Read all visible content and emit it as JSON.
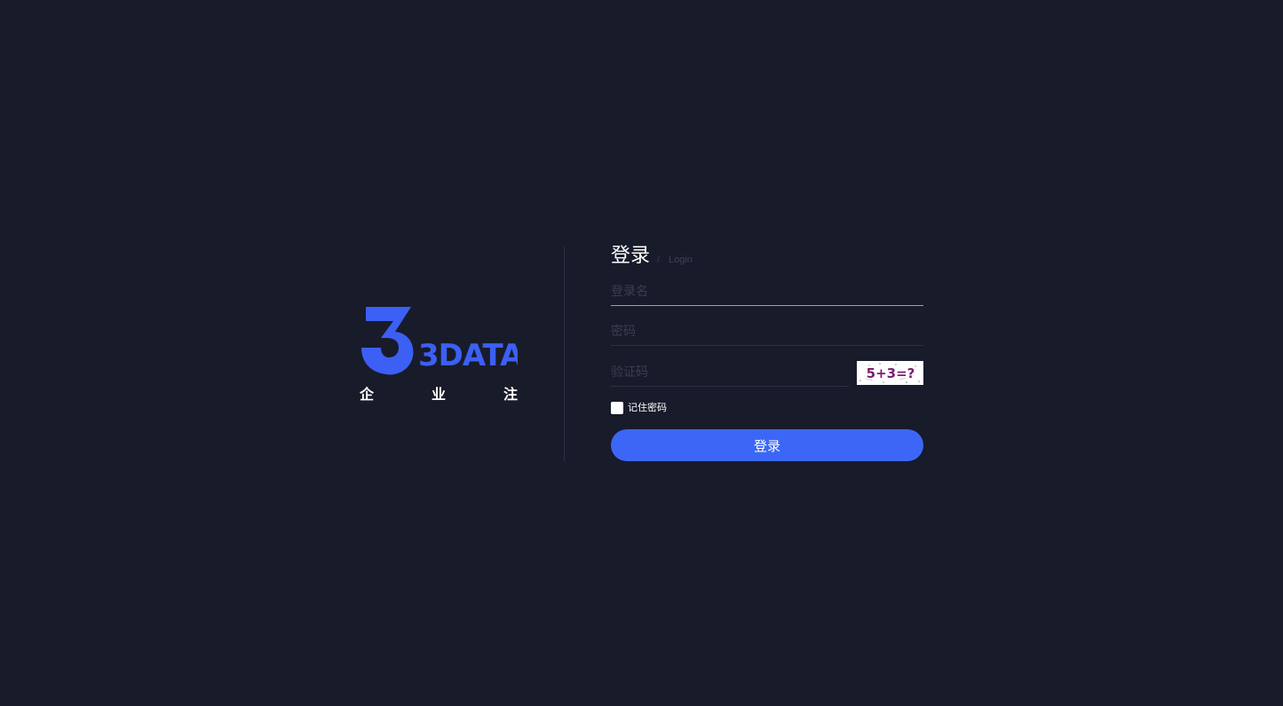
{
  "brand": {
    "logo_text": "3DATA",
    "tagline": [
      "企",
      "业",
      "注"
    ],
    "color": "#3c5ff5"
  },
  "login": {
    "title": "登录",
    "separator": "/",
    "subtitle": "Login",
    "username_placeholder": "登录名",
    "password_placeholder": "密码",
    "captcha_placeholder": "验证码",
    "captcha_text": "5+3=?",
    "remember_label": "记住密码",
    "remember_checked": false,
    "submit_label": "登录"
  },
  "colors": {
    "background": "#181b2a",
    "accent": "#3c67f6",
    "focus_underline": "#c98e93"
  }
}
